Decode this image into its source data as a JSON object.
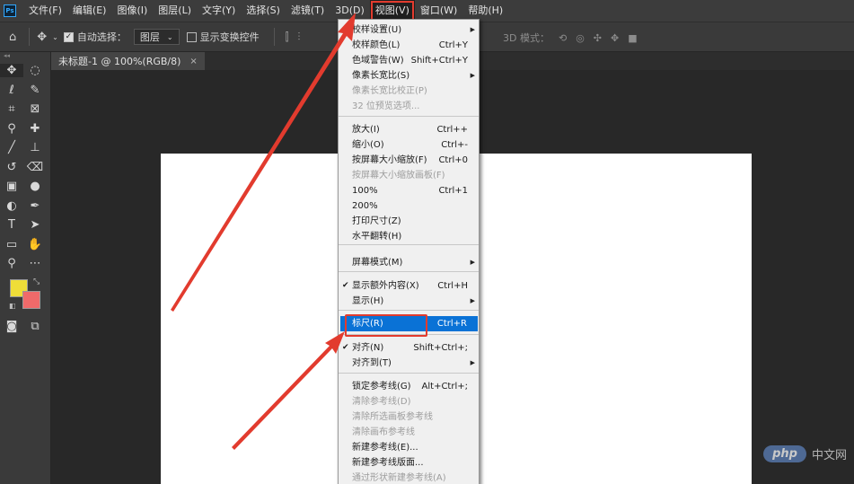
{
  "menubar": {
    "logo": "Ps",
    "items": [
      "文件(F)",
      "编辑(E)",
      "图像(I)",
      "图层(L)",
      "文字(Y)",
      "选择(S)",
      "滤镜(T)",
      "3D(D)",
      "视图(V)",
      "窗口(W)",
      "帮助(H)"
    ]
  },
  "options": {
    "auto_select_label": "自动选择：",
    "layer_select": "图层",
    "show_transform_label": "显示变换控件",
    "threeD_label": "3D 模式："
  },
  "document": {
    "tab_title": "未标题-1 @ 100%(RGB/8)",
    "tab_close": "×"
  },
  "view_menu": {
    "items": [
      {
        "label": "校样设置(U)",
        "shortcut": "",
        "submenu": true,
        "disabled": false,
        "checked": false
      },
      {
        "label": "校样颜色(L)",
        "shortcut": "Ctrl+Y",
        "submenu": false,
        "disabled": false,
        "checked": false
      },
      {
        "label": "色域警告(W)",
        "shortcut": "Shift+Ctrl+Y",
        "submenu": false,
        "disabled": false,
        "checked": false
      },
      {
        "label": "像素长宽比(S)",
        "shortcut": "",
        "submenu": true,
        "disabled": false,
        "checked": false
      },
      {
        "label": "像素长宽比校正(P)",
        "shortcut": "",
        "submenu": false,
        "disabled": true,
        "checked": false
      },
      {
        "label": "32 位预览选项...",
        "shortcut": "",
        "submenu": false,
        "disabled": true,
        "checked": false
      },
      {
        "label": "放大(I)",
        "shortcut": "Ctrl++",
        "submenu": false,
        "disabled": false,
        "checked": false
      },
      {
        "label": "缩小(O)",
        "shortcut": "Ctrl+-",
        "submenu": false,
        "disabled": false,
        "checked": false
      },
      {
        "label": "按屏幕大小缩放(F)",
        "shortcut": "Ctrl+0",
        "submenu": false,
        "disabled": false,
        "checked": false
      },
      {
        "label": "按屏幕大小缩放画板(F)",
        "shortcut": "",
        "submenu": false,
        "disabled": true,
        "checked": false
      },
      {
        "label": "100%",
        "shortcut": "Ctrl+1",
        "submenu": false,
        "disabled": false,
        "checked": false
      },
      {
        "label": "200%",
        "shortcut": "",
        "submenu": false,
        "disabled": false,
        "checked": false
      },
      {
        "label": "打印尺寸(Z)",
        "shortcut": "",
        "submenu": false,
        "disabled": false,
        "checked": false
      },
      {
        "label": "水平翻转(H)",
        "shortcut": "",
        "submenu": false,
        "disabled": false,
        "checked": false
      },
      {
        "label": "屏幕模式(M)",
        "shortcut": "",
        "submenu": true,
        "disabled": false,
        "checked": false
      },
      {
        "label": "显示额外内容(X)",
        "shortcut": "Ctrl+H",
        "submenu": false,
        "disabled": false,
        "checked": true
      },
      {
        "label": "显示(H)",
        "shortcut": "",
        "submenu": true,
        "disabled": false,
        "checked": false
      },
      {
        "label": "标尺(R)",
        "shortcut": "Ctrl+R",
        "submenu": false,
        "disabled": false,
        "checked": false,
        "highlighted": true
      },
      {
        "label": "对齐(N)",
        "shortcut": "Shift+Ctrl+;",
        "submenu": false,
        "disabled": false,
        "checked": true
      },
      {
        "label": "对齐到(T)",
        "shortcut": "",
        "submenu": true,
        "disabled": false,
        "checked": false
      },
      {
        "label": "锁定参考线(G)",
        "shortcut": "Alt+Ctrl+;",
        "submenu": false,
        "disabled": false,
        "checked": false
      },
      {
        "label": "清除参考线(D)",
        "shortcut": "",
        "submenu": false,
        "disabled": true,
        "checked": false
      },
      {
        "label": "清除所选画板参考线",
        "shortcut": "",
        "submenu": false,
        "disabled": true,
        "checked": false
      },
      {
        "label": "清除画布参考线",
        "shortcut": "",
        "submenu": false,
        "disabled": true,
        "checked": false
      },
      {
        "label": "新建参考线(E)...",
        "shortcut": "",
        "submenu": false,
        "disabled": false,
        "checked": false
      },
      {
        "label": "新建参考线版面...",
        "shortcut": "",
        "submenu": false,
        "disabled": false,
        "checked": false
      },
      {
        "label": "通过形状新建参考线(A)",
        "shortcut": "",
        "submenu": false,
        "disabled": true,
        "checked": false
      }
    ]
  },
  "colors": {
    "foreground": "#efdd38",
    "background": "#ef6a6a",
    "annotation": "#e23b2e",
    "menu_highlight": "#0a72d6"
  },
  "watermark": {
    "logo": "php",
    "text": "中文网"
  }
}
